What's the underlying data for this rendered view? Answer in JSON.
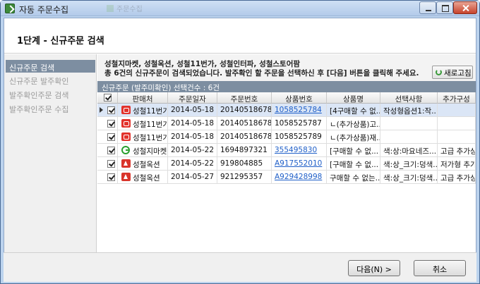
{
  "window": {
    "title": "자동 주문수집",
    "background_tab": "주문수집"
  },
  "step_title": "1단계 - 신규주문 검색",
  "sidebar": {
    "items": [
      {
        "label": "신규주문 검색",
        "active": true
      },
      {
        "label": "신규주문 발주확인",
        "active": false
      },
      {
        "label": "발주확인주문 검색",
        "active": false
      },
      {
        "label": "발주확인주문 수집",
        "active": false
      }
    ]
  },
  "message": {
    "line1": "성철지마켓, 성철옥션, 성철11번가, 성철인터파, 성철스토어팜",
    "line2": "총 6건의 신규주문이 검색되었습니다. 발주확인 할 주문을 선택하신 후 [다음] 버튼을 클릭해 주세요.",
    "refresh_label": "새로고침"
  },
  "grid": {
    "caption": "신규주문 (발주미확인) 선택건수 : 6건",
    "columns": [
      "",
      "판매처",
      "주문일자",
      "주문번호",
      "상품번호",
      "상품명",
      "선택사항",
      "추가구성"
    ],
    "rows": [
      {
        "checked": true,
        "market_icon": "11st-icon",
        "seller": "성철11번가",
        "date": "2014-05-18 ...",
        "order_no": "20140518678...",
        "product_no": "1058525784",
        "product_link": true,
        "product_name": "[4구매할 수 없...",
        "option": "작성형옵션1:작...",
        "extra": ""
      },
      {
        "checked": true,
        "market_icon": "11st-icon",
        "seller": "성철11번가",
        "date": "2014-05-18 ...",
        "order_no": "20140518678...",
        "product_no": "1058525787",
        "product_link": false,
        "product_name": "ㄴ(추가상품)고...",
        "option": "",
        "extra": ""
      },
      {
        "checked": true,
        "market_icon": "11st-icon",
        "seller": "성철11번가",
        "date": "2014-05-18 ...",
        "order_no": "20140518678...",
        "product_no": "1058525789",
        "product_link": false,
        "product_name": "ㄴ(추가상품)재...",
        "option": "",
        "extra": ""
      },
      {
        "checked": true,
        "market_icon": "gmarket-icon",
        "seller": "성철지마켓",
        "date": "2014-05-22 ...",
        "order_no": "1694897321",
        "product_no": "355495830",
        "product_link": true,
        "product_name": "[구매할 수 없...",
        "option": "색:상:마요네즈...",
        "extra": "고급 추가상품"
      },
      {
        "checked": true,
        "market_icon": "auction-icon",
        "seller": "성철옥션",
        "date": "2014-05-22 ...",
        "order_no": "919804885",
        "product_no": "A917552010",
        "product_link": true,
        "product_name": "[구매할 수 없...",
        "option": "색:상_크기:덩색...",
        "extra": "저가형 추가상"
      },
      {
        "checked": true,
        "market_icon": "auction-icon",
        "seller": "성철옥션",
        "date": "2014-05-27 ...",
        "order_no": "921295357",
        "product_no": "A929428998",
        "product_link": true,
        "product_name": "구매할 수 없는...",
        "option": "색:상_크기:덩색...",
        "extra": "고급 추가상품"
      }
    ]
  },
  "buttons": {
    "next_label": "다음(N) >",
    "cancel_label": "취소"
  }
}
